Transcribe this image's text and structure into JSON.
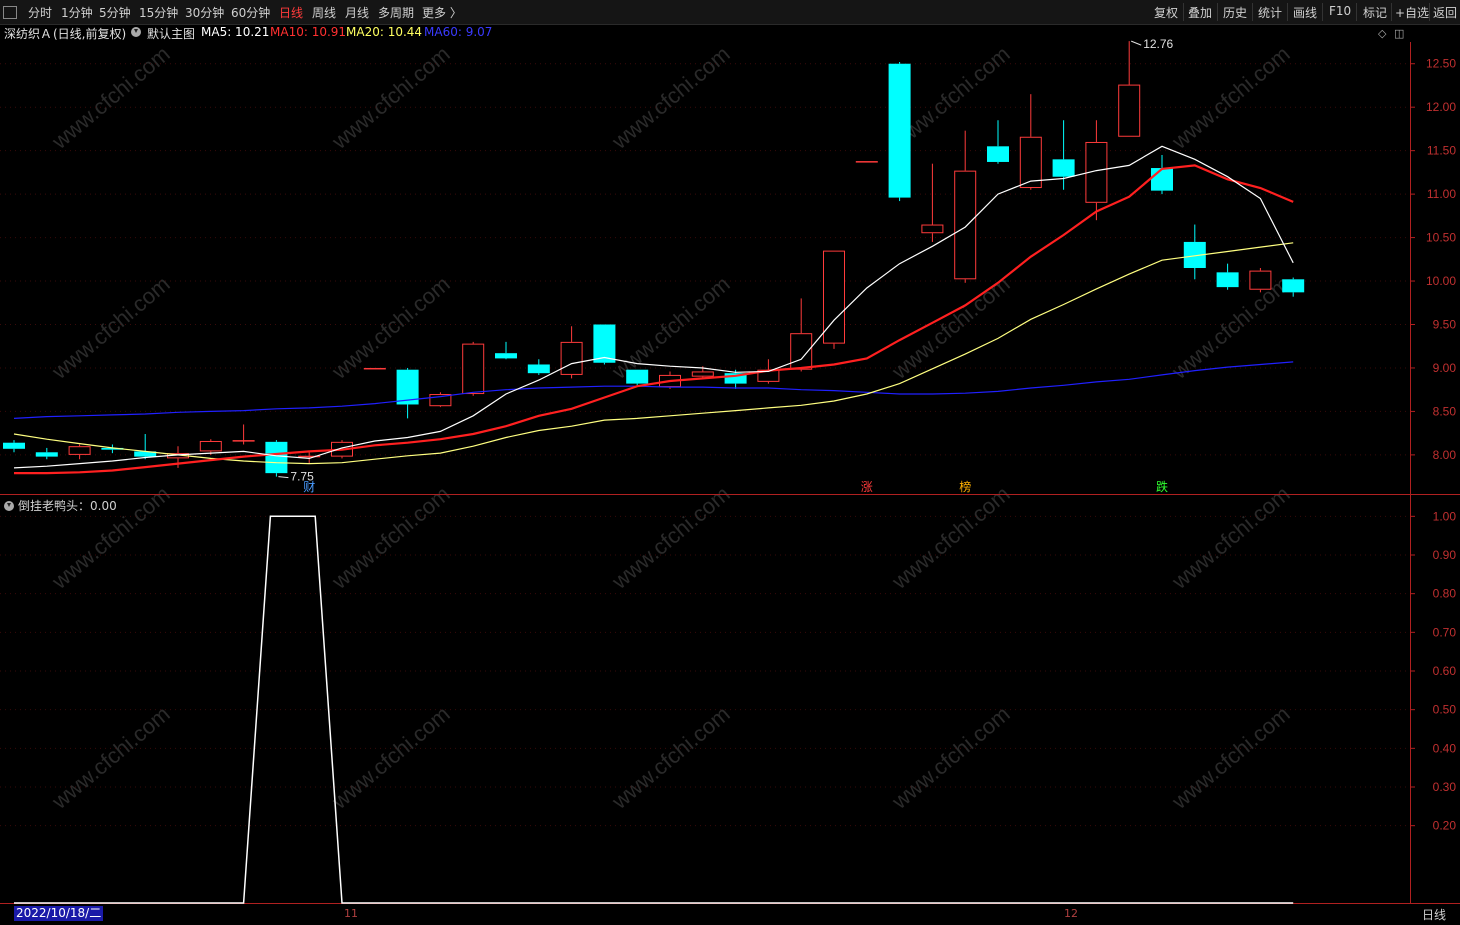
{
  "toolbar": {
    "periods": [
      "分时",
      "1分钟",
      "5分钟",
      "15分钟",
      "30分钟",
      "60分钟",
      "日线",
      "周线",
      "月线",
      "多周期",
      "更多 〉"
    ],
    "active_period": "日线",
    "right_buttons": [
      "复权",
      "叠加",
      "历史",
      "统计",
      "画线",
      "F10",
      "标记",
      "+自选",
      "返回"
    ]
  },
  "info": {
    "stock_name": "深纺织Ａ",
    "mode": "(日线,前复权)",
    "template": "默认主图",
    "ma5": "MA5: 10.21",
    "ma10": "MA10: 10.91",
    "ma20": "MA20: 10.44",
    "ma60": "MA60: 9.07"
  },
  "colors": {
    "up": "#ff3b3b",
    "down": "#00ffff",
    "ma5": "#ffffff",
    "ma10": "#ff2020",
    "ma20": "#ffff80",
    "ma60": "#2020ff",
    "axis": "#b02020"
  },
  "chart_data": [
    {
      "type": "candlestick",
      "title": "",
      "ylim": [
        7.55,
        12.75
      ],
      "ytick_labels": [
        "12.50",
        "12.00",
        "11.50",
        "11.00",
        "10.50",
        "10.00",
        "9.50",
        "9.00",
        "8.50",
        "8.00"
      ],
      "ytick_values": [
        12.5,
        12.0,
        11.5,
        11.0,
        10.5,
        10.0,
        9.5,
        9.0,
        8.5,
        8.0
      ],
      "candles": [
        [
          8.14,
          8.07,
          8.17,
          8.03
        ],
        [
          8.03,
          7.98,
          8.08,
          7.95
        ],
        [
          8.0,
          8.1,
          8.12,
          7.95
        ],
        [
          8.08,
          8.06,
          8.12,
          8.02
        ],
        [
          8.04,
          7.98,
          8.24,
          7.95
        ],
        [
          7.96,
          8.02,
          8.1,
          7.85
        ],
        [
          8.04,
          8.16,
          8.18,
          8.0
        ],
        [
          8.17,
          8.17,
          8.35,
          8.12
        ],
        [
          8.15,
          7.79,
          8.17,
          7.75
        ],
        [
          7.99,
          7.99,
          8.05,
          7.9
        ],
        [
          7.98,
          8.15,
          8.17,
          7.96
        ],
        [
          9.0,
          9.0,
          9.0,
          9.0
        ],
        [
          8.98,
          8.58,
          9.0,
          8.42
        ],
        [
          8.56,
          8.7,
          8.72,
          8.55
        ],
        [
          8.7,
          9.28,
          9.3,
          8.68
        ],
        [
          9.17,
          9.11,
          9.3,
          9.1
        ],
        [
          9.04,
          8.94,
          9.1,
          8.92
        ],
        [
          8.92,
          9.3,
          9.48,
          8.88
        ],
        [
          9.5,
          9.06,
          9.5,
          9.04
        ],
        [
          8.98,
          8.82,
          8.98,
          8.8
        ],
        [
          8.78,
          8.92,
          8.96,
          8.76
        ],
        [
          8.9,
          8.96,
          9.02,
          8.88
        ],
        [
          8.94,
          8.82,
          8.98,
          8.76
        ],
        [
          8.84,
          8.98,
          9.1,
          8.82
        ],
        [
          8.98,
          9.4,
          9.8,
          8.96
        ],
        [
          9.28,
          10.35,
          10.35,
          9.22
        ],
        [
          11.38,
          11.38,
          11.38,
          11.38
        ],
        [
          12.5,
          10.96,
          12.52,
          10.92
        ],
        [
          10.55,
          10.65,
          11.35,
          10.45
        ],
        [
          10.02,
          11.27,
          11.73,
          9.98
        ],
        [
          11.55,
          11.37,
          11.85,
          11.35
        ],
        [
          11.07,
          11.66,
          12.15,
          11.05
        ],
        [
          11.4,
          11.2,
          11.85,
          11.05
        ],
        [
          10.9,
          11.6,
          11.85,
          10.7
        ],
        [
          11.66,
          12.26,
          12.76,
          11.66
        ],
        [
          11.3,
          11.04,
          11.45,
          11.0
        ],
        [
          10.45,
          10.15,
          10.65,
          10.02
        ],
        [
          10.1,
          9.93,
          10.2,
          9.9
        ],
        [
          9.9,
          10.12,
          10.15,
          9.87
        ],
        [
          10.02,
          9.87,
          10.04,
          9.82
        ]
      ],
      "ma5": [
        7.85,
        7.87,
        7.9,
        7.93,
        7.97,
        8.0,
        8.02,
        8.04,
        7.99,
        7.96,
        8.08,
        8.16,
        8.2,
        8.27,
        8.45,
        8.7,
        8.86,
        9.05,
        9.12,
        9.05,
        9.02,
        9.0,
        8.95,
        8.96,
        9.1,
        9.55,
        9.92,
        10.2,
        10.4,
        10.62,
        11.0,
        11.15,
        11.18,
        11.27,
        11.33,
        11.55,
        11.4,
        11.2,
        10.95,
        10.21
      ],
      "ma10": [
        7.79,
        7.79,
        7.8,
        7.82,
        7.86,
        7.9,
        7.94,
        7.98,
        8.01,
        8.04,
        8.06,
        8.11,
        8.14,
        8.18,
        8.24,
        8.33,
        8.45,
        8.53,
        8.66,
        8.79,
        8.85,
        8.88,
        8.91,
        8.97,
        9.0,
        9.04,
        9.11,
        9.32,
        9.52,
        9.72,
        9.98,
        10.28,
        10.53,
        10.8,
        10.97,
        11.29,
        11.33,
        11.17,
        11.07,
        10.91
      ],
      "ma20": [
        8.24,
        8.18,
        8.13,
        8.08,
        8.04,
        8.0,
        7.96,
        7.93,
        7.91,
        7.9,
        7.91,
        7.95,
        7.99,
        8.02,
        8.1,
        8.2,
        8.28,
        8.33,
        8.4,
        8.42,
        8.45,
        8.48,
        8.51,
        8.54,
        8.57,
        8.62,
        8.7,
        8.82,
        8.99,
        9.16,
        9.34,
        9.56,
        9.73,
        9.91,
        10.08,
        10.24,
        10.29,
        10.34,
        10.39,
        10.44
      ],
      "ma60": [
        8.42,
        8.44,
        8.45,
        8.46,
        8.47,
        8.49,
        8.5,
        8.51,
        8.53,
        8.54,
        8.56,
        8.59,
        8.63,
        8.67,
        8.72,
        8.75,
        8.77,
        8.78,
        8.79,
        8.79,
        8.78,
        8.78,
        8.77,
        8.77,
        8.75,
        8.74,
        8.72,
        8.7,
        8.7,
        8.71,
        8.73,
        8.77,
        8.8,
        8.84,
        8.87,
        8.92,
        8.97,
        9.01,
        9.04,
        9.07
      ],
      "annotations": [
        {
          "label": "7.75",
          "index": 8,
          "value": 7.75
        },
        {
          "label": "12.76",
          "index": 34,
          "value": 12.76
        }
      ],
      "markers": [
        {
          "label": "财",
          "index": 9,
          "color": "#4a9cff"
        },
        {
          "label": "涨",
          "index": 26,
          "color": "#ff3b3b"
        },
        {
          "label": "榜",
          "index": 29,
          "color": "#ffb000"
        },
        {
          "label": "跌",
          "index": 35,
          "color": "#30ff30"
        }
      ]
    },
    {
      "type": "line",
      "title": "倒挂老鸭头",
      "value_label": "倒挂老鸭头：0.00",
      "ylim": [
        0,
        1.05
      ],
      "ytick_labels": [
        "1.00",
        "0.90",
        "0.80",
        "0.70",
        "0.60",
        "0.50",
        "0.40",
        "0.30",
        "0.20"
      ],
      "ytick_values": [
        1.0,
        0.9,
        0.8,
        0.7,
        0.6,
        0.5,
        0.4,
        0.3,
        0.2
      ],
      "values": [
        0,
        0,
        0,
        0,
        0,
        0,
        0,
        0,
        1,
        1,
        0,
        0,
        0,
        0,
        0,
        0,
        0,
        0,
        0,
        0,
        0,
        0,
        0,
        0,
        0,
        0,
        0,
        0,
        0,
        0,
        0,
        0,
        0,
        0,
        0,
        0,
        0,
        0,
        0,
        0
      ]
    }
  ],
  "xaxis": {
    "start_date": "2022/10/18/二",
    "month_ticks": [
      {
        "label": "11",
        "index": 10
      },
      {
        "label": "12",
        "index": 32
      }
    ],
    "period_label": "日线"
  },
  "watermark": "www.cfchi.com"
}
